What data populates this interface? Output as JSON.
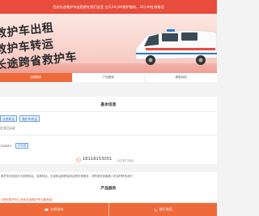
{
  "topbar": {
    "notice": "西安长途救护车出租就在我们这里 全天24小时救护服务，24小时在线电话"
  },
  "banner": {
    "slogan_1": "救护车出租",
    "slogan_2": "救护车转运",
    "slogan_3": "长途跨省救护车"
  },
  "tabs": [
    {
      "label": "店铺首页",
      "active": true
    },
    {
      "label": "产品服务",
      "active": false
    },
    {
      "label": "商家动态",
      "active": false
    }
  ],
  "basic_info": {
    "title": "基本信息",
    "tags": [
      "长途转运",
      "救护车转运"
    ],
    "line_1": "企业已认证",
    "phone_short": "150851",
    "verify_label": "已认证"
  },
  "contact": {
    "phone": "18118153051",
    "hint": "(点击拨打电话)"
  },
  "description": "救护车的用途分为常规转运、急救转运、长途转运和跨省转运等多种服务，详情请咨询客服人员及时联系我们",
  "products": {
    "title": "产品服务",
    "first_item": "【西安救护车】西安长途救护车出租转运"
  },
  "bottom": {
    "left_label": "在线咨询",
    "right_label": "拨打电话"
  },
  "colors": {
    "accent": "#ef6a3a",
    "top": "#e74c3c",
    "link": "#2b73c5"
  }
}
